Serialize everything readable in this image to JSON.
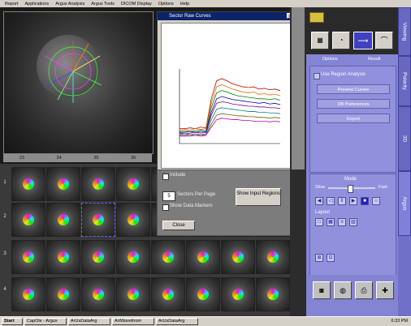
{
  "menu": [
    "Report",
    "Applications",
    "Argus Analysis",
    "Argus Tools",
    "DICOM Display",
    "Options",
    "Help"
  ],
  "column_numbers": [
    "23",
    "24",
    "25",
    "26"
  ],
  "row_numbers": [
    "1",
    "2",
    "3",
    "4"
  ],
  "graph_window": {
    "title": "Sector Raw Curves"
  },
  "study_panel": {
    "include_label": "Include",
    "sectors_value": "5",
    "sectors_label": "Sectors Per Page",
    "show_input_label": "Show Input Regions",
    "show_markers_label": "Show Data Markers",
    "close_label": "Close"
  },
  "right_panel": {
    "subtabs": [
      "Options",
      "Result"
    ],
    "use_region_label": "Use Region Analysis",
    "preview_curves": "Preview Curves",
    "db_preferences": "DB Preferences",
    "export": "Export",
    "mode_label": "Mode",
    "slow_label": "Slow",
    "fast_label": "Fast",
    "layout_label": "Layout"
  },
  "vertical_tabs": [
    "Viewing",
    "Polarity",
    "3D",
    "Argus"
  ],
  "taskbar": {
    "start": "Start",
    "tasks": [
      "CapOle - Argus",
      "ArUsDataArg",
      "ArtWaveltrom",
      "ArUsDataArg"
    ],
    "clock": "6:33 PM"
  },
  "chart_data": {
    "type": "line",
    "title": "Sector Raw Curves",
    "xlabel": "",
    "ylabel": "",
    "ylim": [
      0,
      10
    ],
    "x": [
      0,
      1,
      2,
      3,
      4,
      5,
      6,
      7,
      8,
      9,
      10,
      11,
      12,
      13,
      14,
      15,
      16,
      17,
      18,
      19
    ],
    "series": [
      {
        "values": [
          2,
          2,
          2.1,
          2,
          2.2,
          2.1,
          6,
          8.4,
          8.7,
          8.4,
          8.0,
          7.8,
          7.6,
          7.5,
          7.6,
          7.3,
          7.4,
          7.2,
          7.3,
          7.1
        ]
      },
      {
        "values": [
          1.8,
          1.9,
          1.8,
          2,
          1.9,
          2,
          5.4,
          7.6,
          7.9,
          7.6,
          7.3,
          7.1,
          6.9,
          6.8,
          6.9,
          6.6,
          6.7,
          6.5,
          6.6,
          6.4
        ]
      },
      {
        "values": [
          1.6,
          1.7,
          1.6,
          1.7,
          1.8,
          1.7,
          4.8,
          6.8,
          7.1,
          6.9,
          6.6,
          6.4,
          6.3,
          6.2,
          6.1,
          6.0,
          6.0,
          5.9,
          6.0,
          5.8
        ]
      },
      {
        "values": [
          1.5,
          1.5,
          1.6,
          1.5,
          1.6,
          1.6,
          4.2,
          6.0,
          6.3,
          6.1,
          5.9,
          5.8,
          5.7,
          5.6,
          5.5,
          5.4,
          5.5,
          5.3,
          5.4,
          5.2
        ]
      },
      {
        "values": [
          1.4,
          1.3,
          1.4,
          1.5,
          1.4,
          1.5,
          3.8,
          5.4,
          5.6,
          5.5,
          5.3,
          5.2,
          5.1,
          5.0,
          5.0,
          4.9,
          4.9,
          4.8,
          4.8,
          4.7
        ]
      },
      {
        "values": [
          1.2,
          1.3,
          1.2,
          1.3,
          1.2,
          1.3,
          3.2,
          4.6,
          4.8,
          4.7,
          4.6,
          4.5,
          4.4,
          4.3,
          4.3,
          4.2,
          4.2,
          4.1,
          4.1,
          4.0
        ]
      },
      {
        "values": [
          1.1,
          1.1,
          1.2,
          1.1,
          1.2,
          1.1,
          2.6,
          3.8,
          4.0,
          3.9,
          3.8,
          3.7,
          3.7,
          3.6,
          3.6,
          3.5,
          3.5,
          3.4,
          3.5,
          3.4
        ]
      },
      {
        "values": [
          1.0,
          1.0,
          1.0,
          1.1,
          1.0,
          1.1,
          2.2,
          3.2,
          3.4,
          3.3,
          3.2,
          3.2,
          3.1,
          3.1,
          3.0,
          3.0,
          3.0,
          2.9,
          3.0,
          2.9
        ]
      }
    ],
    "colors": [
      "#c00000",
      "#e07000",
      "#008000",
      "#0000c0",
      "#800080",
      "#008080",
      "#606000",
      "#c000c0"
    ]
  }
}
